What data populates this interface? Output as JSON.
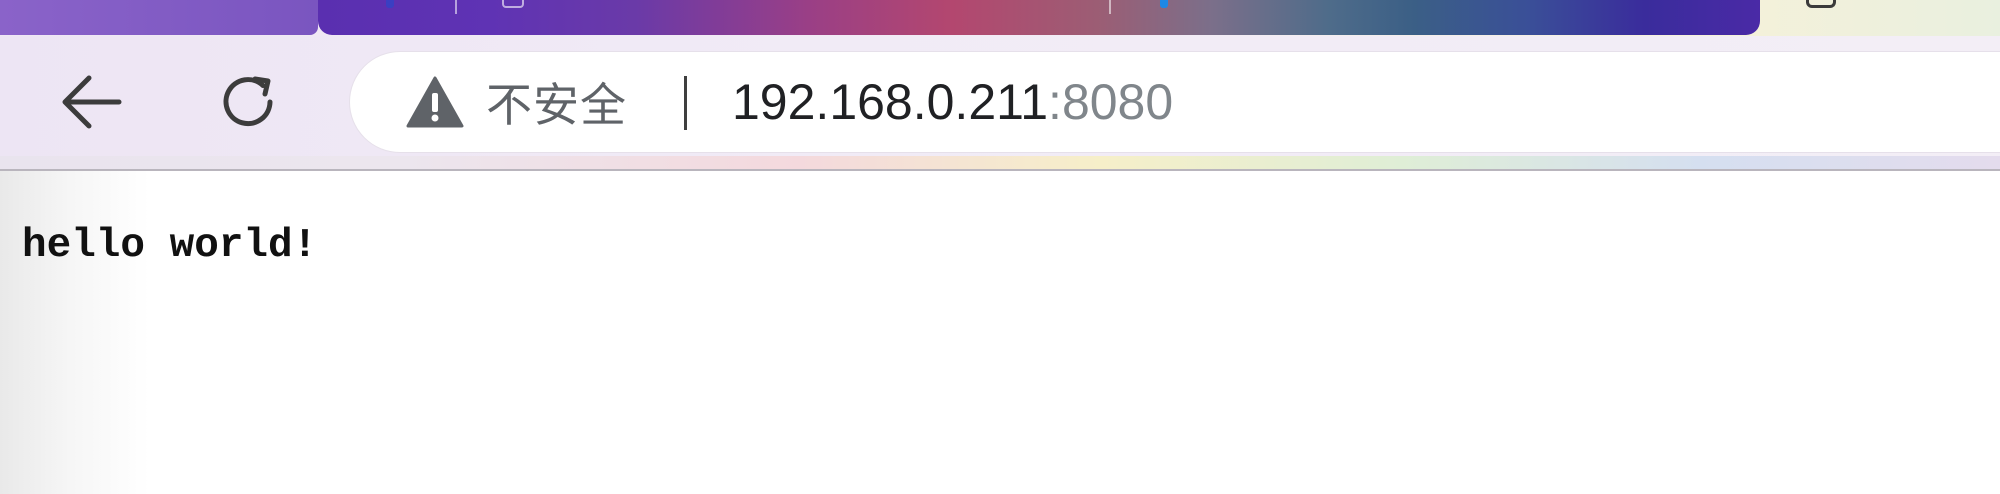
{
  "browser": {
    "toolbar": {
      "back_icon": "arrow-left-icon",
      "reload_icon": "reload-icon"
    },
    "address_bar": {
      "security_icon": "warning-triangle-icon",
      "security_label": "不安全",
      "url_host": "192.168.0.211",
      "url_port": ":8080"
    }
  },
  "page": {
    "body_text": "hello world!"
  },
  "colors": {
    "tab_accent": "#7a55c0",
    "page_background": "#ffffff",
    "url_host_color": "#202124",
    "url_port_color": "#80868b"
  }
}
